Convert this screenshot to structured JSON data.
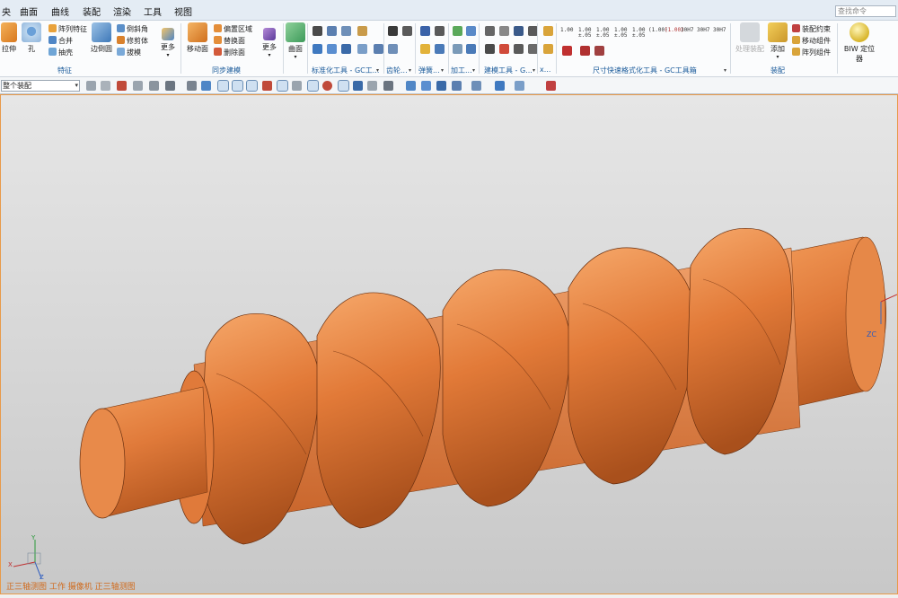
{
  "menu": {
    "items": [
      "央",
      "曲面",
      "曲线",
      "装配",
      "渲染",
      "工具",
      "视图"
    ],
    "search_placeholder": "查找命令"
  },
  "ribbon": {
    "feature": {
      "extrude": "拉伸",
      "hole": "孔",
      "pattern_feature": "阵列特征",
      "unite": "合并",
      "shell": "抽壳",
      "edge_blend": "边倒圆",
      "chamfer": "倒斜角",
      "trim_body": "修剪体",
      "draft": "拔模",
      "more": "更多",
      "group_label": "特征"
    },
    "sync": {
      "move_face": "移动面",
      "offset_region": "偏置区域",
      "replace_face": "替换面",
      "delete_face": "删除面",
      "more": "更多",
      "group_label": "同步建模"
    },
    "surface": {
      "surface": "曲面"
    },
    "group_labels": {
      "standard_tools": "标准化工具 - GC工...",
      "gear": "齿轮...",
      "spring": "弹簧...",
      "machining": "加工...",
      "modeling_tools": "建模工具 - G...",
      "more_x": "x...",
      "dim_tools": "尺寸快速格式化工具 - GC工具箱",
      "assembly": "装配"
    },
    "assembly": {
      "context": "处理装配",
      "add": "添加",
      "constraint": "装配约束",
      "move_component": "移动组件",
      "pattern_component": "阵列组件"
    },
    "biw": {
      "locator": "BIW 定位器"
    },
    "dim_icons": [
      "1.00",
      "1.00\n±.05",
      "1.00\n±.05",
      "1.00\n±.05",
      "1.00\n±.05",
      "(1.00)",
      "(1.00)",
      "30H7",
      "30H7",
      "30H7"
    ]
  },
  "toolbar2": {
    "filter_value": "整个装配"
  },
  "viewport": {
    "status": "正三轴测图 工作 摄像机 正三轴测图",
    "triad_x": "X",
    "triad_y": "Y",
    "triad_z": "Z",
    "zc_label": "ZC",
    "model_color": "#e07a3a",
    "background_top": "#e6e6e6",
    "background_bottom": "#c8c8c8"
  }
}
